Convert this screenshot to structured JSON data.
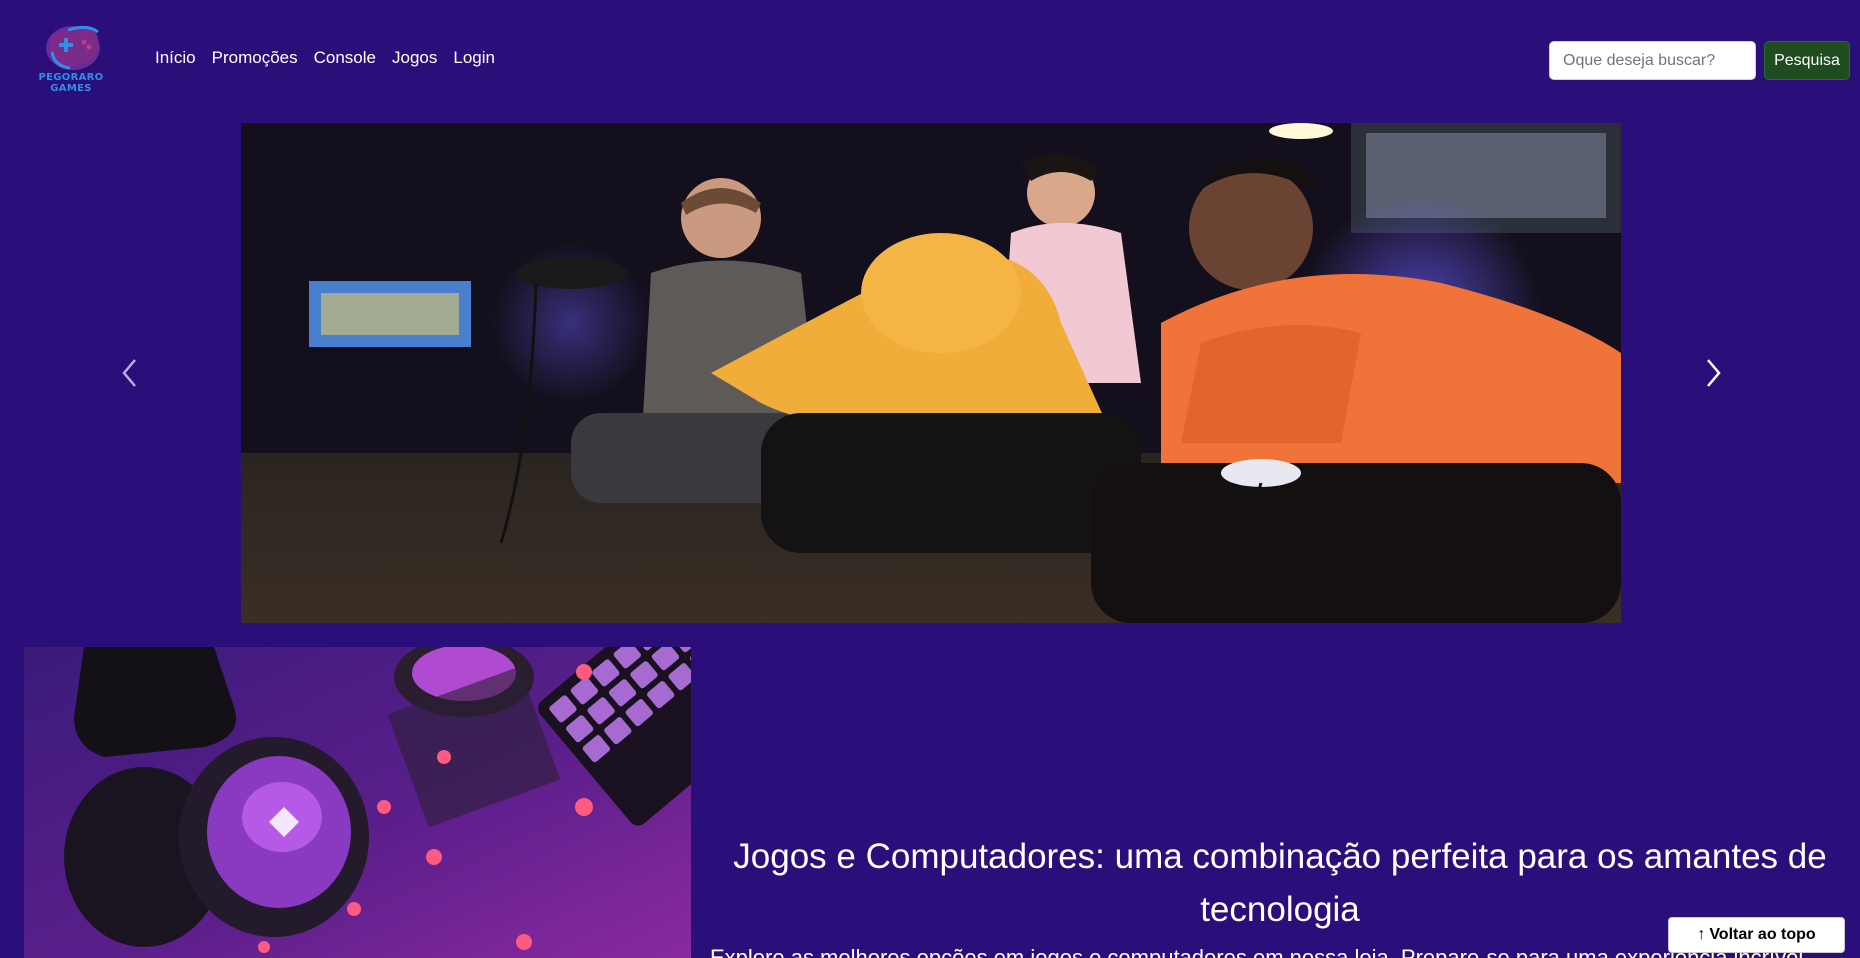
{
  "brand": {
    "name": "PEGORARO GAMES"
  },
  "nav": {
    "items": [
      {
        "label": "Início"
      },
      {
        "label": "Promoções"
      },
      {
        "label": "Console"
      },
      {
        "label": "Jogos"
      },
      {
        "label": "Login"
      }
    ]
  },
  "search": {
    "placeholder": "Oque deseja buscar?",
    "value": "",
    "button_label": "Pesquisa"
  },
  "carousel": {
    "prev_icon": "chevron-left-icon",
    "next_icon": "chevron-right-icon",
    "slide_alt": "Jovens jogando videogame"
  },
  "feature": {
    "title": "Jogos e Computadores: uma combinação perfeita para os amantes de tecnologia",
    "text": "Explore as melhores opções em jogos e computadores em nossa loja. Prepare-se para uma experiência incrível"
  },
  "back_to_top": {
    "icon": "arrow-up-icon",
    "label": "Voltar ao topo"
  },
  "colors": {
    "background": "#2a0f7a",
    "search_button": "#1f4d1f",
    "logo_accent": "#2f8fe8"
  }
}
